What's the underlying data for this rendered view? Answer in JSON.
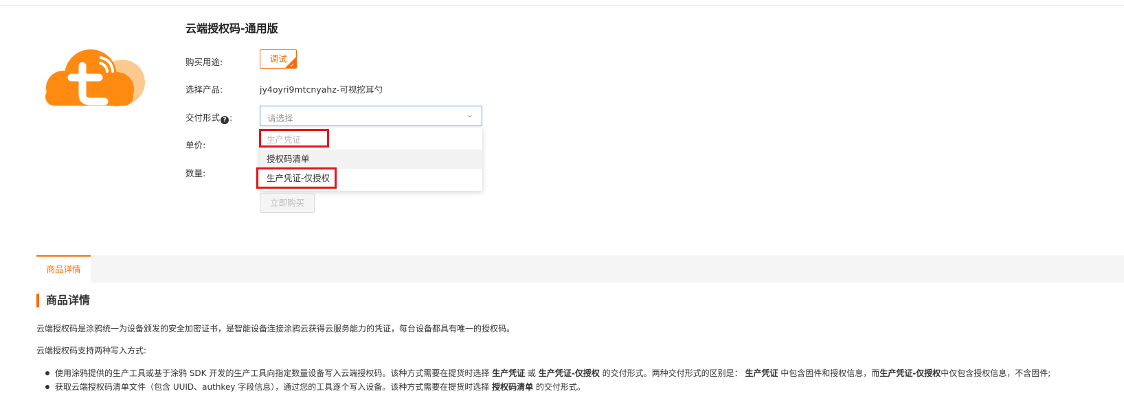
{
  "product": {
    "title": "云端授权码-通用版",
    "logo": "tuya-cloud-logo"
  },
  "form": {
    "purpose_label": "购买用途:",
    "purpose_option": "调试",
    "product_label": "选择产品:",
    "product_value": "jy4oyri9mtcnyahz-可视挖耳勺",
    "delivery_label_prefix": "交付形式",
    "delivery_label_suffix": ":",
    "delivery_placeholder": "请选择",
    "price_label": "单价:",
    "quantity_label": "数量:",
    "buy_button": "立即购买"
  },
  "dropdown": {
    "options": [
      "生产凭证",
      "授权码清单",
      "生产凭证-仅授权"
    ]
  },
  "tabs": {
    "details": "商品详情"
  },
  "details": {
    "heading": "商品详情",
    "para1": "云端授权码是涂鸦统一为设备颁发的安全加密证书，是智能设备连接涂鸦云获得云服务能力的凭证，每台设备都具有唯一的授权码。",
    "para2": "云端授权码支持两种写入方式:",
    "bullet1": {
      "t1": "使用涂鸦提供的生产工具或基于涂鸦 SDK 开发的生产工具向指定数量设备写入云端授权码。该种方式需要在提货时选择 ",
      "b1": "生产凭证",
      "t2": " 或 ",
      "b2": "生产凭证-仅授权",
      "t3": " 的交付形式。两种交付形式的区别是： ",
      "b3": "生产凭证",
      "t4": " 中包含固件和授权信息，而",
      "b4": "生产凭证-仅授权",
      "t5": "中仅包含授权信息，不含固件;"
    },
    "bullet2": {
      "t1": "获取云端授权码清单文件（包含 UUID、authkey 字段信息），通过您的工具逐个写入设备。该种方式需要在提货时选择 ",
      "b1": "授权码清单",
      "t2": " 的交付形式。"
    }
  },
  "colors": {
    "accent": "#ff6a00",
    "highlight": "#e5151b",
    "focus": "#5b9bf0"
  }
}
